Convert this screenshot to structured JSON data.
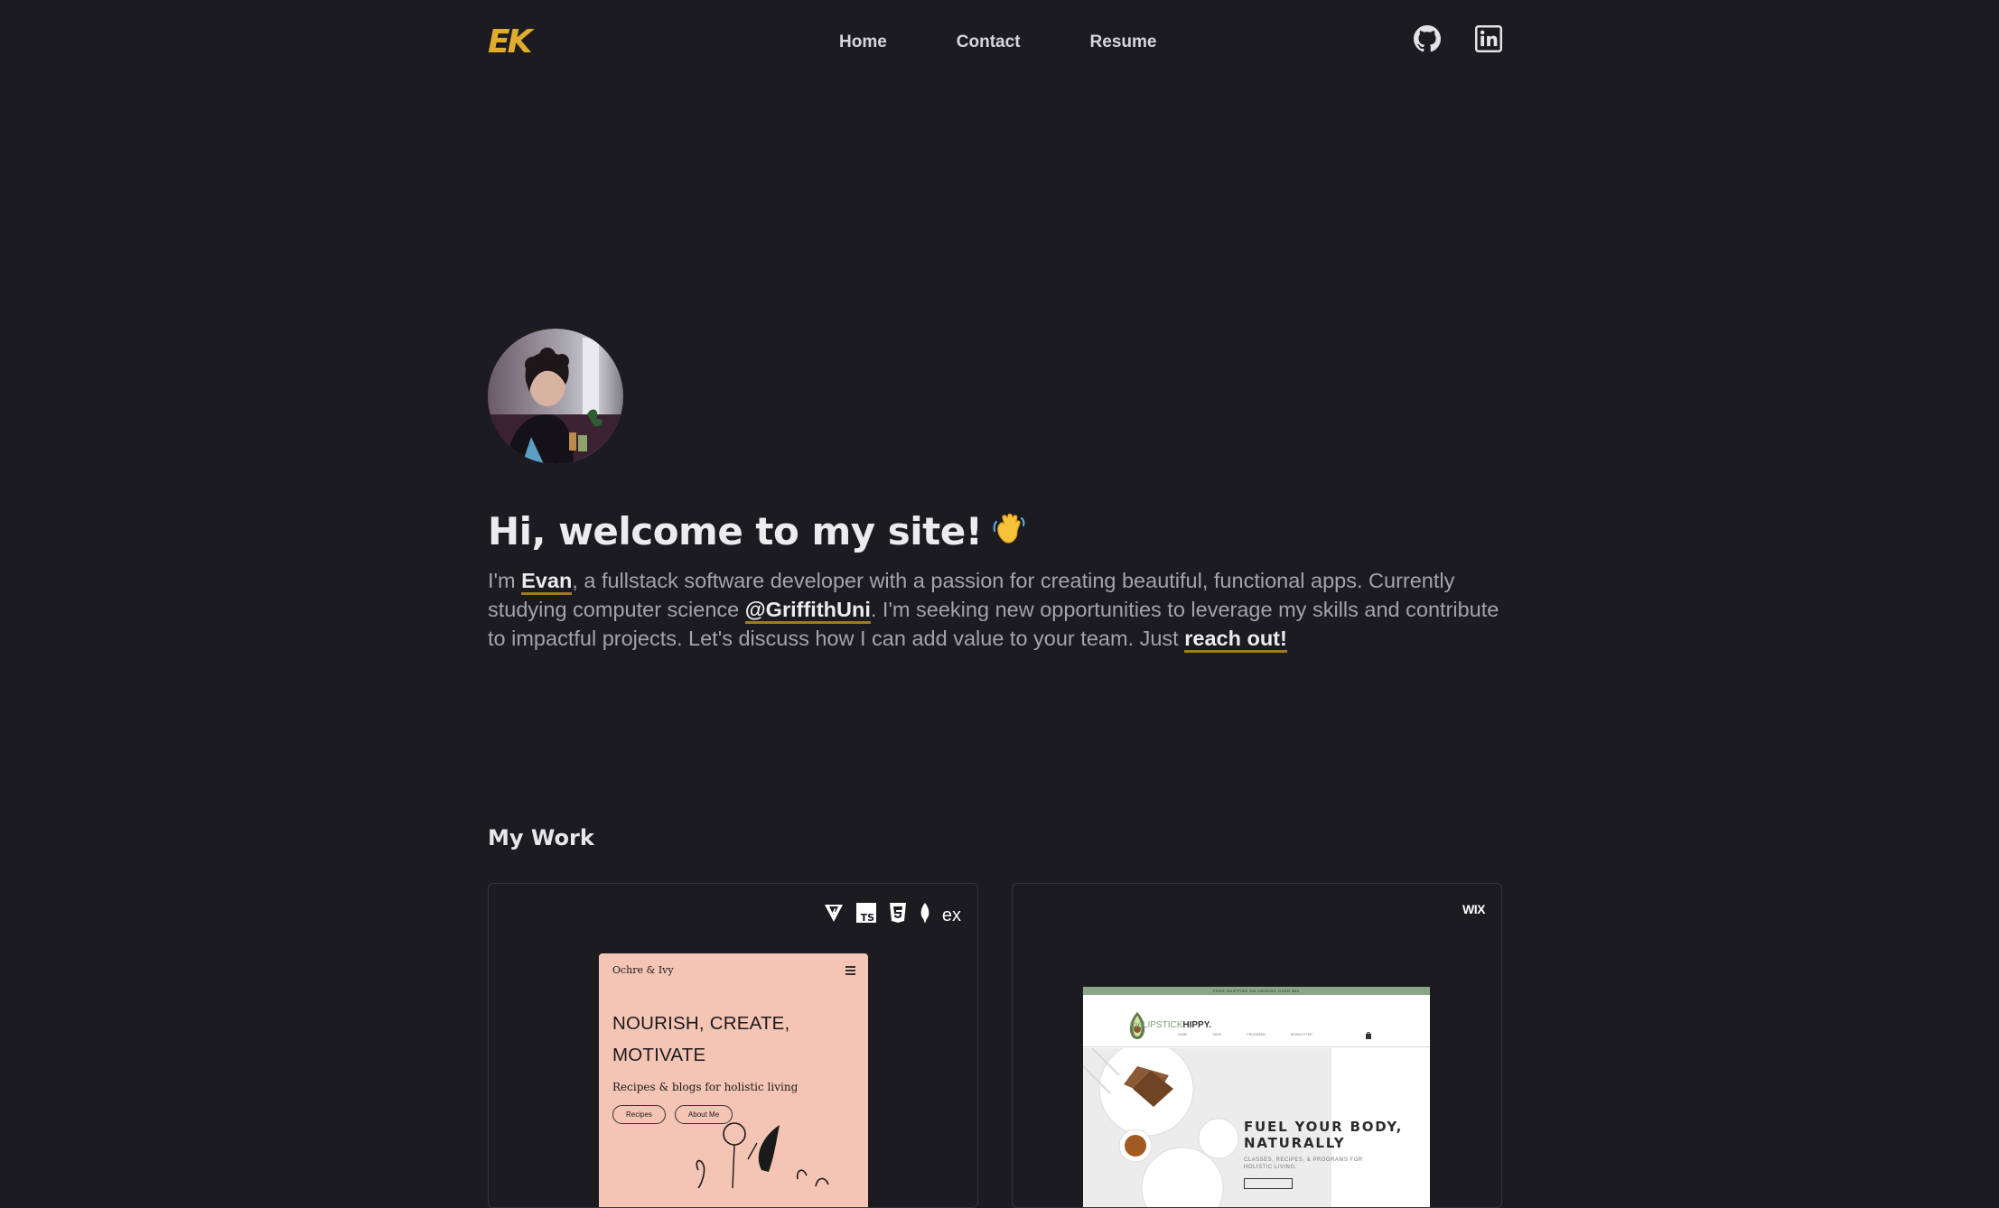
{
  "nav": {
    "logo": "EK",
    "links": [
      {
        "label": "Home"
      },
      {
        "label": "Contact"
      },
      {
        "label": "Resume"
      }
    ],
    "social": [
      {
        "icon": "github-icon"
      },
      {
        "icon": "linkedin-icon"
      }
    ]
  },
  "hero": {
    "title": "Hi, welcome to my site!",
    "wave_icon": "waving-hand-icon",
    "intro_1": "I'm ",
    "name_link": "Evan",
    "intro_2": ", a fullstack software developer with a passion for creating beautiful, functional apps. Currently studying computer science ",
    "uni_link": "@GriffithUni",
    "intro_3": ". I'm seeking new opportunities to leverage my skills and contribute to impactful projects. Let's discuss how I can add value to your team. Just ",
    "contact_link": "reach out!"
  },
  "work": {
    "title": "My Work",
    "projects": [
      {
        "tech_icons": [
          "vite-icon",
          "typescript-icon",
          "css3-icon",
          "mongodb-icon",
          "express-icon"
        ],
        "tech_text": "ex",
        "preview": {
          "brand": "Ochre & Ivy",
          "headline": "NOURISH, CREATE, MOTIVATE",
          "subtitle": "Recipes & blogs for holistic living",
          "buttons": [
            "Recipes",
            "About Me"
          ]
        }
      },
      {
        "tech_icons": [
          "wix-icon"
        ],
        "tech_text": "WIX",
        "preview": {
          "banner": "FREE SHIPPING ON ORDERS OVER $50",
          "brand_prefix": "the",
          "brand_mid": "LIPSTICK",
          "brand_suffix": "HIPPY.",
          "nav": [
            "HOME",
            "SHOP",
            "PROGRAMS",
            "NEWSLETTER"
          ],
          "headline_1": "FUEL YOUR BODY,",
          "headline_2": "NATURALLY",
          "subtitle": "CLASSES, RECIPES, & PROGRAMS FOR HOLISTIC LIVING."
        }
      }
    ]
  },
  "colors": {
    "background": "#1c1b20",
    "accent": "#e0ac2e",
    "underline": "#a07a20",
    "text_muted": "#a3a3aa",
    "card_border": "#34333a"
  }
}
